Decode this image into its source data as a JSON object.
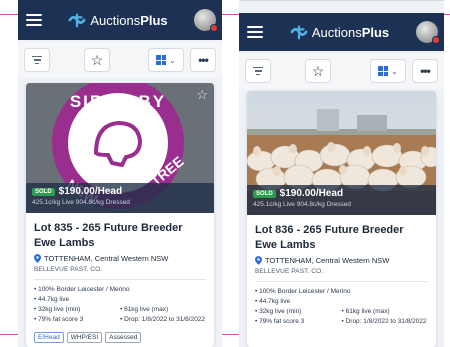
{
  "colors": {
    "header": "#1c3153",
    "accent": "#c25b9c",
    "sold": "#2a9d4e",
    "link": "#2d6bd8"
  },
  "app": {
    "brand_light": "Auctions",
    "brand_bold": "Plus"
  },
  "icons": {
    "menu": "hamburger-icon",
    "filter": "filter-icon",
    "favorite": "star-icon",
    "view": "grid-view-icon",
    "more": "more-icon",
    "location": "pin-icon"
  },
  "toolbar": {
    "more_label": "•••",
    "view_chevron": "⌄"
  },
  "listings": [
    {
      "image_text": "SIRED BY NEW...TREE",
      "sold_label": "SOLD",
      "price": "$190.00/Head",
      "price_detail": "425.1c/kg Live 904.8c/kg Dressed",
      "title": "Lot 835 - 265 Future Breeder Ewe Lambs",
      "location": "TOTTENHAM, Central Western NSW",
      "vendor": "BELLEVUE PAST. CO.",
      "attributes": [
        "• 100% Border Leicester / Merino",
        "• 44.7kg live"
      ],
      "attr_pairs": [
        [
          "• 32kg live (min)",
          "• 61kg live (max)"
        ],
        [
          "• 79% fat score 3",
          "• Drop: 1/8/2022 to 31/8/2022"
        ]
      ],
      "tags": [
        "E/Head",
        "WHP/ESI",
        "Assessed"
      ]
    },
    {
      "sold_label": "SOLD",
      "price": "$190.00/Head",
      "price_detail": "425.1c/kg Live 904.8c/kg Dressed",
      "title": "Lot 836 - 265 Future Breeder Ewe Lambs",
      "location": "TOTTENHAM, Central Western NSW",
      "vendor": "BELLEVUE PAST. CO.",
      "attributes": [
        "• 100% Border Leicester / Merino",
        "• 44.7kg live"
      ],
      "attr_pairs": [
        [
          "• 32kg live (min)",
          "• 61kg live (max)"
        ],
        [
          "• 79% fat score 3",
          "• Drop: 1/8/2022 to 31/8/2022"
        ]
      ]
    }
  ]
}
